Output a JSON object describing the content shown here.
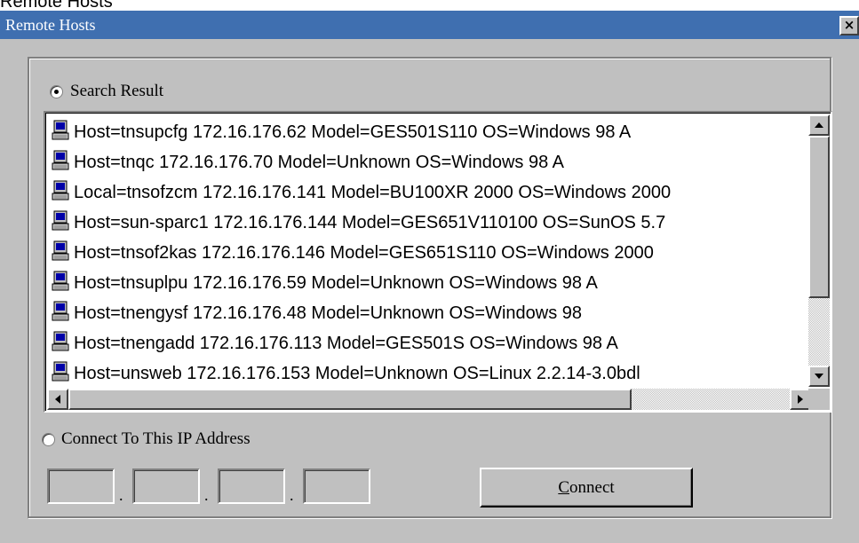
{
  "top_text": "Remote Hosts",
  "window": {
    "title": "Remote Hosts",
    "close_label": "×"
  },
  "search_result": {
    "label": "Search Result",
    "selected": true
  },
  "hosts": [
    "Host=tnsupcfg 172.16.176.62  Model=GES501S110       OS=Windows 98  A",
    "Host=tnqc 172.16.176.70  Model=Unknown  OS=Windows 98  A",
    "Local=tnsofzcm 172.16.176.141  Model=BU100XR 2000       OS=Windows 2000",
    "Host=sun-sparc1 172.16.176.144  Model=GES651V110100  OS=SunOS 5.7",
    "Host=tnsof2kas 172.16.176.146  Model=GES651S110  OS=Windows 2000",
    "Host=tnsuplpu 172.16.176.59  Model=Unknown  OS=Windows 98  A",
    "Host=tnengysf 172.16.176.48  Model=Unknown  OS=Windows 98",
    "Host=tnengadd 172.16.176.113  Model=GES501S  OS=Windows 98  A",
    "Host=unsweb 172.16.176.153  Model=Unknown  OS=Linux  2.2.14-3.0bdl"
  ],
  "connect_ip": {
    "label": "Connect To This IP Address",
    "selected": false,
    "octets": [
      "",
      "",
      "",
      ""
    ]
  },
  "buttons": {
    "connect_mnemonic": "C",
    "connect_rest": "onnect"
  },
  "icons": {
    "host": "computer-icon",
    "close": "close-icon",
    "scroll_up": "arrow-up-icon",
    "scroll_down": "arrow-down-icon",
    "scroll_left": "arrow-left-icon",
    "scroll_right": "arrow-right-icon"
  }
}
